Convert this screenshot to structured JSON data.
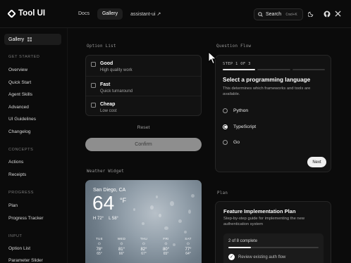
{
  "header": {
    "brand": "Tool UI",
    "nav": [
      {
        "label": "Docs"
      },
      {
        "label": "Gallery"
      },
      {
        "label": "assistant-ui ↗"
      }
    ],
    "search": {
      "label": "Search",
      "shortcut": "Cmd+K"
    },
    "icons": [
      "moon-icon",
      "github-icon",
      "x-icon"
    ]
  },
  "sidebar": {
    "gallery": "Gallery",
    "sections": [
      {
        "title": "GET STARTED",
        "items": [
          "Overview",
          "Quick Start",
          "Agent Skills",
          "Advanced",
          "UI Guidelines",
          "Changelog"
        ]
      },
      {
        "title": "CONCEPTS",
        "items": [
          "Actions",
          "Receipts"
        ]
      },
      {
        "title": "PROGRESS",
        "items": [
          "Plan",
          "Progress Tracker"
        ]
      },
      {
        "title": "INPUT",
        "items": [
          "Option List",
          "Parameter Slider"
        ]
      }
    ]
  },
  "option_list": {
    "panel_title": "Option List",
    "options": [
      {
        "title": "Good",
        "subtitle": "High quality work"
      },
      {
        "title": "Fast",
        "subtitle": "Quick turnaround"
      },
      {
        "title": "Cheap",
        "subtitle": "Low cost"
      }
    ],
    "reset": "Reset",
    "confirm": "Confirm"
  },
  "weather": {
    "panel_title": "Weather Widget",
    "city": "San Diego, CA",
    "temp": "64",
    "unit": "°F",
    "high": "H 72°",
    "low": "L 58°",
    "days": [
      {
        "day": "TUE",
        "icon": "☼",
        "high": "78°",
        "low": "65°"
      },
      {
        "day": "WED",
        "icon": "☼",
        "high": "81°",
        "low": "66°"
      },
      {
        "day": "THU",
        "icon": "☼",
        "high": "82°",
        "low": "67°"
      },
      {
        "day": "FRI",
        "icon": "☼",
        "high": "80°",
        "low": "65°"
      },
      {
        "day": "SAT",
        "icon": "☼",
        "high": "77°",
        "low": "64°"
      }
    ]
  },
  "question_flow": {
    "panel_title": "Question Flow",
    "step": "STEP 1 OF 3",
    "title": "Select a programming language",
    "description": "This determines which frameworks and tools are available.",
    "options": [
      {
        "label": "Python",
        "selected": false
      },
      {
        "label": "TypeScript",
        "selected": true
      },
      {
        "label": "Go",
        "selected": false
      }
    ],
    "next": "Next"
  },
  "plan": {
    "panel_title": "Plan",
    "title": "Feature Implementation Plan",
    "description": "Step-by-step guide for implementing the new authentication system",
    "progress_label": "2 of 8 complete",
    "progress_fraction": 0.25,
    "first_item": "Review existing auth flow"
  },
  "colors": {
    "background": "#0b0b0b",
    "card": "#121212",
    "border": "#262626",
    "confirm_disabled": "#8e8e8e"
  }
}
